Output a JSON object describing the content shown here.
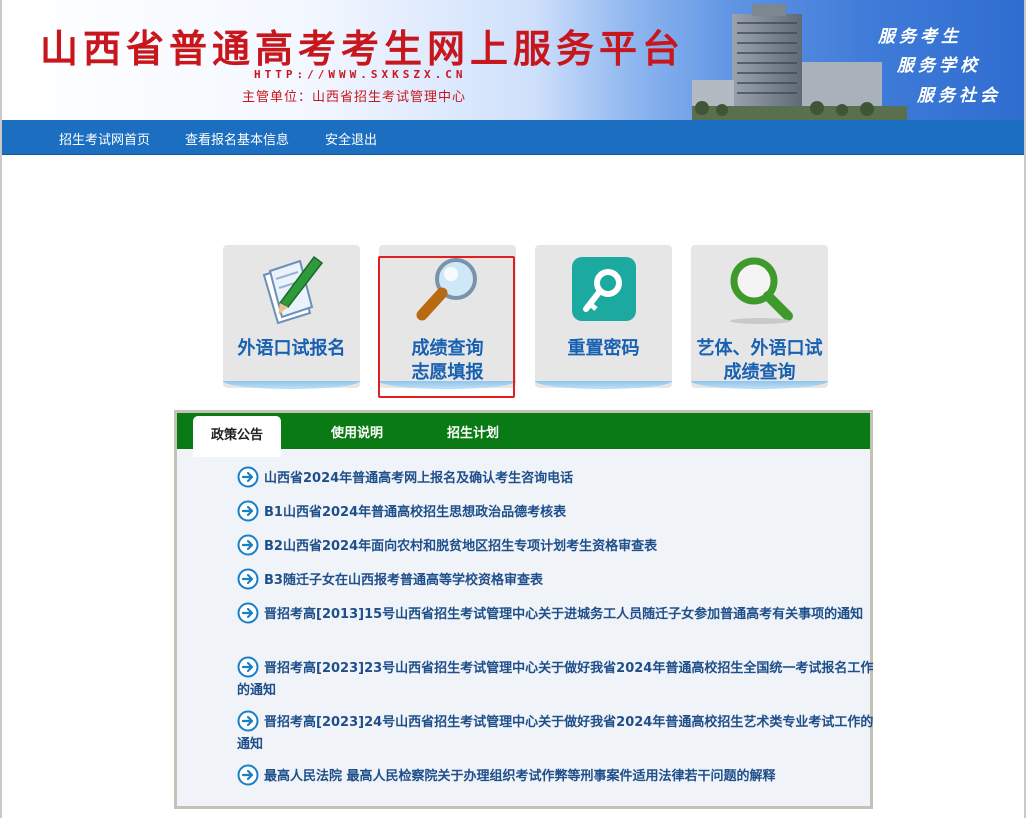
{
  "header": {
    "title": "山西省普通高考考生网上服务平台",
    "url": "HTTP://WWW.SXKSZX.CN",
    "org": "主管单位：山西省招生考试管理中心",
    "slogans": [
      "服务考生",
      "服务学校",
      "服务社会"
    ]
  },
  "nav": {
    "items": [
      "招生考试网首页",
      "查看报名基本信息",
      "安全退出"
    ]
  },
  "tiles": [
    {
      "line1": "外语口试报名",
      "line2": "",
      "icon": "pen-paper-icon"
    },
    {
      "line1": "成绩查询",
      "line2": "志愿填报",
      "icon": "magnifier-icon"
    },
    {
      "line1": "重置密码",
      "line2": "",
      "icon": "key-icon"
    },
    {
      "line1": "艺体、外语口试",
      "line2": "成绩查询",
      "icon": "search-icon"
    }
  ],
  "tabs": {
    "items": [
      "政策公告",
      "使用说明",
      "招生计划"
    ],
    "active": "政策公告"
  },
  "news": [
    "山西省2024年普通高考网上报名及确认考生咨询电话",
    "B1山西省2024年普通高校招生思想政治品德考核表",
    "B2山西省2024年面向农村和脱贫地区招生专项计划考生资格审查表",
    "B3随迁子女在山西报考普通高等学校资格审查表",
    "晋招考高[2013]15号山西省招生考试管理中心关于进城务工人员随迁子女参加普通高考有关事项的通知",
    "晋招考高[2023]23号山西省招生考试管理中心关于做好我省2024年普通高校招生全国统一考试报名工作的通知",
    "晋招考高[2023]24号山西省招生考试管理中心关于做好我省2024年普通高校招生艺术类专业考试工作的通知",
    "最高人民法院 最高人民检察院关于办理组织考试作弊等刑事案件适用法律若干问题的解释"
  ],
  "colors": {
    "title_red": "#c8161d",
    "nav_blue": "#1c6fc0",
    "tile_text": "#1760b2",
    "tab_green": "#0a7a14",
    "news_text": "#1f4f8a",
    "highlight_red": "#e02020"
  }
}
